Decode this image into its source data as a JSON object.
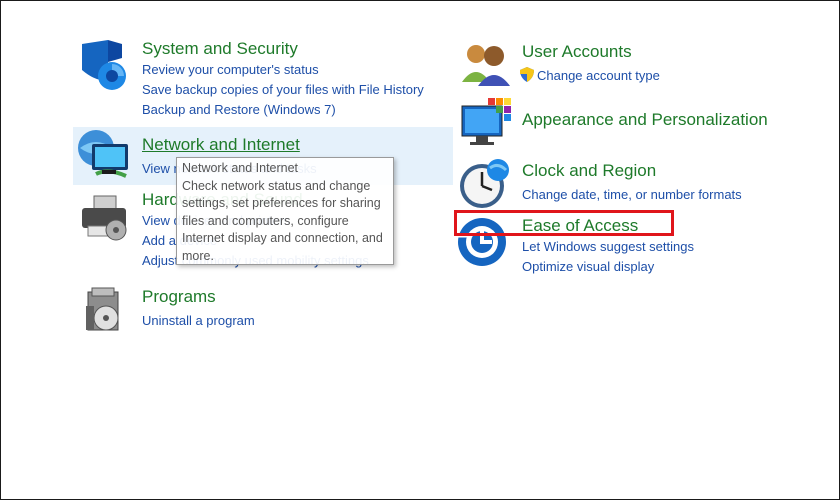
{
  "categories": {
    "system_security": {
      "title": "System and Security",
      "links": [
        "Review your computer's status",
        "Save backup copies of your files with File History",
        "Backup and Restore (Windows 7)"
      ]
    },
    "network_internet": {
      "title": "Network and Internet",
      "links": [
        "View network status and tasks"
      ]
    },
    "hardware_sound": {
      "title": "Hardware and Sound",
      "links": [
        "View devices and printers",
        "Add a device",
        "Adjust commonly used mobility settings"
      ]
    },
    "programs": {
      "title": "Programs",
      "links": [
        "Uninstall a program"
      ]
    },
    "user_accounts": {
      "title": "User Accounts",
      "links": [
        "Change account type"
      ]
    },
    "appearance": {
      "title": "Appearance and Personalization",
      "links": []
    },
    "clock_region": {
      "title": "Clock and Region",
      "links": [
        "Change date, time, or number formats"
      ]
    },
    "ease_of_access": {
      "title": "Ease of Access",
      "links": [
        "Let Windows suggest settings",
        "Optimize visual display"
      ]
    }
  },
  "tooltip": {
    "text": "Network and Internet\nCheck network status and change settings, set preferences for sharing files and computers, configure Internet display and connection, and more."
  },
  "colors": {
    "title_green": "#1e7a2a",
    "link_blue": "#1e4fa8",
    "highlight": "#e5f1fb",
    "annotation_red": "#e0151b"
  }
}
